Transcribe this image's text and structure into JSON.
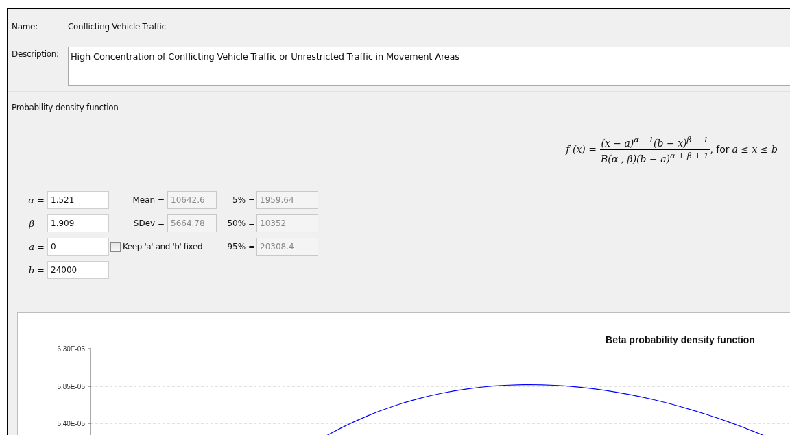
{
  "name": {
    "label": "Name:",
    "value": "Conflicting Vehicle Traffic"
  },
  "description": {
    "label": "Description:",
    "value": "High Concentration of Conflicting Vehicle Traffic or Unrestricted Traffic in Movement Areas"
  },
  "pdf_group": {
    "title": "Probability density function",
    "formula": {
      "lhs": "f (x) =",
      "numerator": "(x − a)$^{α −1}$(b − x)$^{β − 1}$",
      "denominator": "B(α , β)(b − a)$^{α + β + 1}$",
      "suffix": ", for",
      "condition": "a ≤ x ≤ b"
    },
    "parameters": [
      {
        "label": "α =",
        "value": "1.521"
      },
      {
        "label": "β =",
        "value": "1.909"
      },
      {
        "label": "a =",
        "value": "0"
      },
      {
        "label": "b =",
        "value": "24000"
      }
    ],
    "statistics": [
      {
        "label": "Mean =",
        "value": "10642.6",
        "disabled": true
      },
      {
        "label": "SDev =",
        "value": "5664.78",
        "disabled": true
      }
    ],
    "keep_fixed": {
      "label": "Keep 'a' and 'b' fixed",
      "checked": false
    },
    "percentiles": [
      {
        "label": "5% =",
        "value": "1959.64",
        "disabled": true
      },
      {
        "label": "50% =",
        "value": "10352",
        "disabled": true
      },
      {
        "label": "95% =",
        "value": "20308.4",
        "disabled": true
      }
    ],
    "chart": {
      "title": "Beta probability density function",
      "y_tick_labels": [
        "6.30E-05",
        "5.85E-05",
        "5.40E-05"
      ]
    }
  }
}
